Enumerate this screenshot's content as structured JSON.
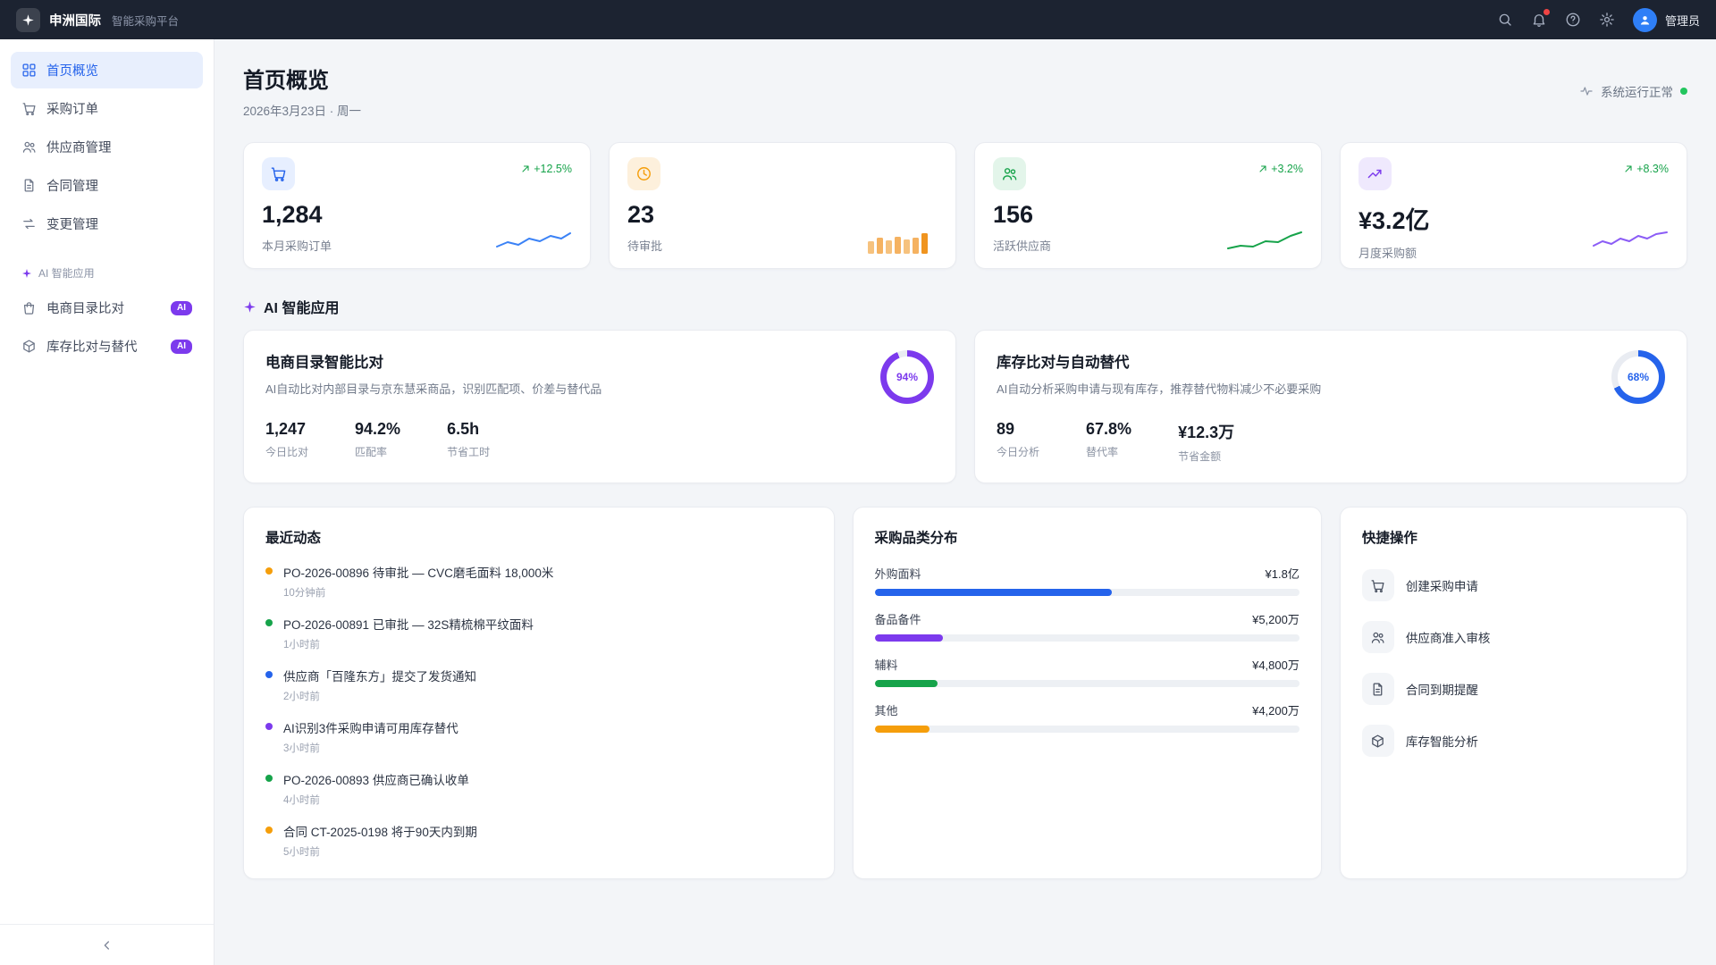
{
  "topbar": {
    "brand": "申洲国际",
    "subtitle": "智能采购平台",
    "user": "管理员",
    "icons": [
      "search-icon",
      "bell-icon",
      "help-icon",
      "gear-icon",
      "avatar"
    ]
  },
  "sidebar": {
    "items": [
      {
        "label": "首页概览",
        "icon": "grid-icon",
        "active": true
      },
      {
        "label": "采购订单",
        "icon": "cart-icon"
      },
      {
        "label": "供应商管理",
        "icon": "people-icon"
      },
      {
        "label": "合同管理",
        "icon": "document-icon"
      },
      {
        "label": "变更管理",
        "icon": "swap-icon"
      }
    ],
    "section_label": "AI 智能应用",
    "ai_items": [
      {
        "label": "电商目录比对",
        "badge": "AI",
        "icon": "bag-icon"
      },
      {
        "label": "库存比对与替代",
        "badge": "AI",
        "icon": "box-icon"
      }
    ]
  },
  "header": {
    "title": "首页概览",
    "date": "2026年3月23日 · 周一",
    "status": "系统运行正常",
    "status_color": "#22c55e"
  },
  "stats": [
    {
      "value": "1,284",
      "label": "本月采购订单",
      "delta": "+12.5%",
      "icon": "cart-icon",
      "accent": "#2563eb"
    },
    {
      "value": "23",
      "label": "待审批",
      "delta": "",
      "icon": "clock-icon",
      "accent": "#f59e0b"
    },
    {
      "value": "156",
      "label": "活跃供应商",
      "delta": "+3.2%",
      "icon": "people-icon",
      "accent": "#16a34a"
    },
    {
      "value": "¥3.2亿",
      "label": "月度采购额",
      "delta": "+8.3%",
      "icon": "trend-up-icon",
      "accent": "#7c3aed"
    }
  ],
  "ai": {
    "section_title": "AI 智能应用",
    "cards": [
      {
        "title": "电商目录智能比对",
        "desc": "AI自动比对内部目录与京东慧采商品，识别匹配项、价差与替代品",
        "percent_label": "94%",
        "stats": [
          {
            "value": "1,247",
            "label": "今日比对"
          },
          {
            "value": "94.2%",
            "label": "匹配率"
          },
          {
            "value": "6.5h",
            "label": "节省工时"
          }
        ]
      },
      {
        "title": "库存比对与自动替代",
        "desc": "AI自动分析采购申请与现有库存，推荐替代物料减少不必要采购",
        "percent_label": "68%",
        "stats": [
          {
            "value": "89",
            "label": "今日分析"
          },
          {
            "value": "67.8%",
            "label": "替代率"
          },
          {
            "value": "¥12.3万",
            "label": "节省金额"
          }
        ]
      }
    ]
  },
  "activity": {
    "title": "最近动态",
    "items": [
      {
        "text": "PO-2026-00896 待审批 — CVC磨毛面料 18,000米",
        "time": "10分钟前",
        "color": "#f59e0b"
      },
      {
        "text": "PO-2026-00891 已审批 — 32S精梳棉平纹面料",
        "time": "1小时前",
        "color": "#16a34a"
      },
      {
        "text": "供应商「百隆东方」提交了发货通知",
        "time": "2小时前",
        "color": "#2563eb"
      },
      {
        "text": "AI识别3件采购申请可用库存替代",
        "time": "3小时前",
        "color": "#7c3aed"
      },
      {
        "text": "PO-2026-00893 供应商已确认收单",
        "time": "4小时前",
        "color": "#16a34a"
      },
      {
        "text": "合同 CT-2025-0198 将于90天内到期",
        "time": "5小时前",
        "color": "#f59e0b"
      }
    ]
  },
  "categories": {
    "title": "采购品类分布"
  },
  "quick": {
    "title": "快捷操作",
    "items": [
      {
        "label": "创建采购申请",
        "icon": "cart-icon"
      },
      {
        "label": "供应商准入审核",
        "icon": "people-icon"
      },
      {
        "label": "合同到期提醒",
        "icon": "document-icon"
      },
      {
        "label": "库存智能分析",
        "icon": "box-icon"
      }
    ]
  },
  "chart_data": [
    {
      "type": "bar",
      "title": "采购品类分布",
      "orientation": "horizontal",
      "categories": [
        "外购面料",
        "备品备件",
        "辅料",
        "其他"
      ],
      "value_labels": [
        "¥1.8亿",
        "¥5,200万",
        "¥4,800万",
        "¥4,200万"
      ],
      "values_wan": [
        18000,
        5200,
        4800,
        4200
      ],
      "colors": [
        "#2563eb",
        "#7c3aed",
        "#16a34a",
        "#f59e0b"
      ]
    },
    {
      "type": "donut",
      "title": "电商目录智能比对",
      "value": 94,
      "label": "94%",
      "color": "#7c3aed"
    },
    {
      "type": "donut",
      "title": "库存比对与自动替代",
      "value": 68,
      "label": "68%",
      "color": "#2563eb"
    }
  ]
}
